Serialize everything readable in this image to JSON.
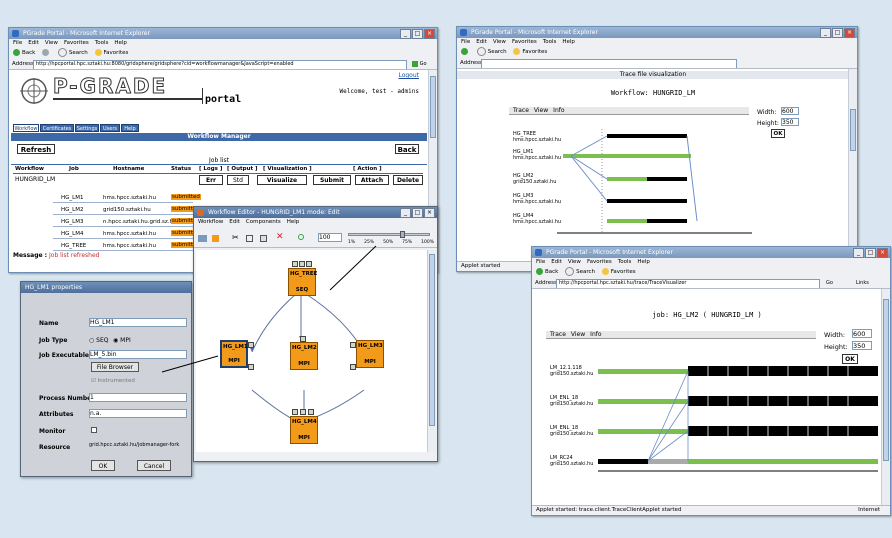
{
  "colors": {
    "accent": "#3e69a8",
    "node": "#f29a1a",
    "bar_green": "#7bbf4e",
    "bar_black": "#000000",
    "error_text": "#c03030"
  },
  "win1": {
    "title": "PGrade Portal - Microsoft Internet Explorer",
    "menu": [
      "File",
      "Edit",
      "View",
      "Favorites",
      "Tools",
      "Help"
    ],
    "toolbar": [
      "Back",
      "Search",
      "Favorites"
    ],
    "address_label": "Address",
    "address": "http://hpcportal.hpc.sztaki.hu:8080/gridsphere/gridsphere?cid=workflowmanager&JavaScript=enabled",
    "go": "Go",
    "logo": "P-GRADE",
    "logo_sub": "portal",
    "logout": "Logout",
    "welcome": "Welcome, test - admins",
    "tabs": [
      "Workflow",
      "Certificates",
      "Settings",
      "Users",
      "Help"
    ],
    "panel_title": "Workflow Manager",
    "refresh": "Refresh",
    "back": "Back",
    "joblist_title": "Job list",
    "columns": [
      "Workflow",
      "Job",
      "Hostname",
      "Status",
      "[ Logs ]",
      "[ Output ]",
      "[ Visualization ]",
      "[ Action ]"
    ],
    "workflow_name": "HUNGRID_LM",
    "row_buttons": {
      "err": "Err",
      "out": "Std",
      "visualize": "Visualize",
      "submit": "Submit",
      "attach": "Attach",
      "delete": "Delete"
    },
    "jobs": [
      {
        "job": "HG_LM1",
        "host": "hms.hpcc.sztaki.hu",
        "status": "submitted"
      },
      {
        "job": "HG_LM2",
        "host": "grid150.sztaki.hu",
        "status": "submitted"
      },
      {
        "job": "HG_LM3",
        "host": "n.hpcc.sztaki.hu.grid.sz.hu",
        "status": "submitted"
      },
      {
        "job": "HG_LM4",
        "host": "hms.hpcc.sztaki.hu",
        "status": "submitted"
      },
      {
        "job": "HG_TREE",
        "host": "hms.hpcc.sztaki.hu",
        "status": "submitted"
      }
    ],
    "message_label": "Message :",
    "message_text": "Job list refreshed"
  },
  "props": {
    "title": "HG_LM1 properties",
    "labels": {
      "name": "Name",
      "jobtype": "Job Type",
      "exec": "Job Executable",
      "procs": "Process Number",
      "attrs": "Attributes",
      "monitor": "Monitor",
      "resource": "Resource"
    },
    "name_value": "HG_LM1",
    "jobtype_seq": "SEQ",
    "jobtype_mpi": "MPI",
    "exec_value": "LM_5.bin",
    "file_browser": "File Browser",
    "instrument": "Instrumented",
    "procs_value": "1",
    "attrs_value": "n.a.",
    "resource_value": "grid.hpcc.sztaki.hu/jobmanager-fork",
    "ok": "OK",
    "cancel": "Cancel"
  },
  "editor": {
    "title": "Workflow Editor - HUNGRID_LM1 mode: Edit",
    "menu": [
      "Workflow",
      "Edit",
      "Components",
      "Help"
    ],
    "zoom": "100",
    "ruler": [
      "1%",
      "25%",
      "50%",
      "75%",
      "100%"
    ],
    "nodes": {
      "top": "HG_TREE",
      "left": "HG_LM1",
      "mid": "HG_LM2",
      "right": "HG_LM3",
      "bottom": "HG_LM4"
    },
    "node_type_seq": "SEQ",
    "node_type_mpi": "MPI"
  },
  "win2": {
    "title": "PGrade Portal - Microsoft Internet Explorer",
    "menu": [
      "File",
      "Edit",
      "View",
      "Favorites",
      "Tools",
      "Help"
    ],
    "toolbar": [
      "Search",
      "Favorites"
    ],
    "address_label": "Address",
    "header": "Trace file visualization",
    "subtitle": "Workflow: HUNGRID_LM",
    "tool_menu": [
      "Trace",
      "View",
      "Info"
    ],
    "width_label": "Width:",
    "width_value": "600",
    "height_label": "Height:",
    "height_value": "350",
    "ok": "OK",
    "rows": [
      {
        "name": "HG_TREE",
        "host": "hms.hpcc.sztaki.hu"
      },
      {
        "name": "HG_LM1",
        "host": "hms.hpcc.sztaki.hu"
      },
      {
        "name": "HG_LM2",
        "host": "grid150.sztaki.hu"
      },
      {
        "name": "HG_LM3",
        "host": "hms.hpcc.sztaki.hu"
      },
      {
        "name": "HG_LM4",
        "host": "hms.hpcc.sztaki.hu"
      }
    ],
    "status": "Applet started"
  },
  "win3": {
    "title": "PGrade Portal - Microsoft Internet Explorer",
    "menu": [
      "File",
      "Edit",
      "View",
      "Favorites",
      "Tools",
      "Help"
    ],
    "toolbar": [
      "Back",
      "Search",
      "Favorites"
    ],
    "address_label": "Address",
    "address": "http://hpcportal.hpc.sztaki.hu/trace/TraceVisualizer",
    "go": "Go",
    "links": "Links",
    "header": "job: HG_LM2 ( HUNGRID_LM )",
    "tool_menu": [
      "Trace",
      "View",
      "Info"
    ],
    "width_label": "Width:",
    "width_value": "600",
    "height_label": "Height:",
    "height_value": "350",
    "ok": "OK",
    "rows": [
      {
        "name": "LM_12.1.118",
        "host": "grid150.sztaki.hu"
      },
      {
        "name": "LM_ENL_18",
        "host": "grid150.sztaki.hu"
      },
      {
        "name": "LM_ENL_18",
        "host": "grid150.sztaki.hu"
      },
      {
        "name": "LM_RC24",
        "host": "grid150.sztaki.hu"
      }
    ],
    "status": "Applet started: trace.client.TraceClientApplet started",
    "zone": "Internet"
  }
}
